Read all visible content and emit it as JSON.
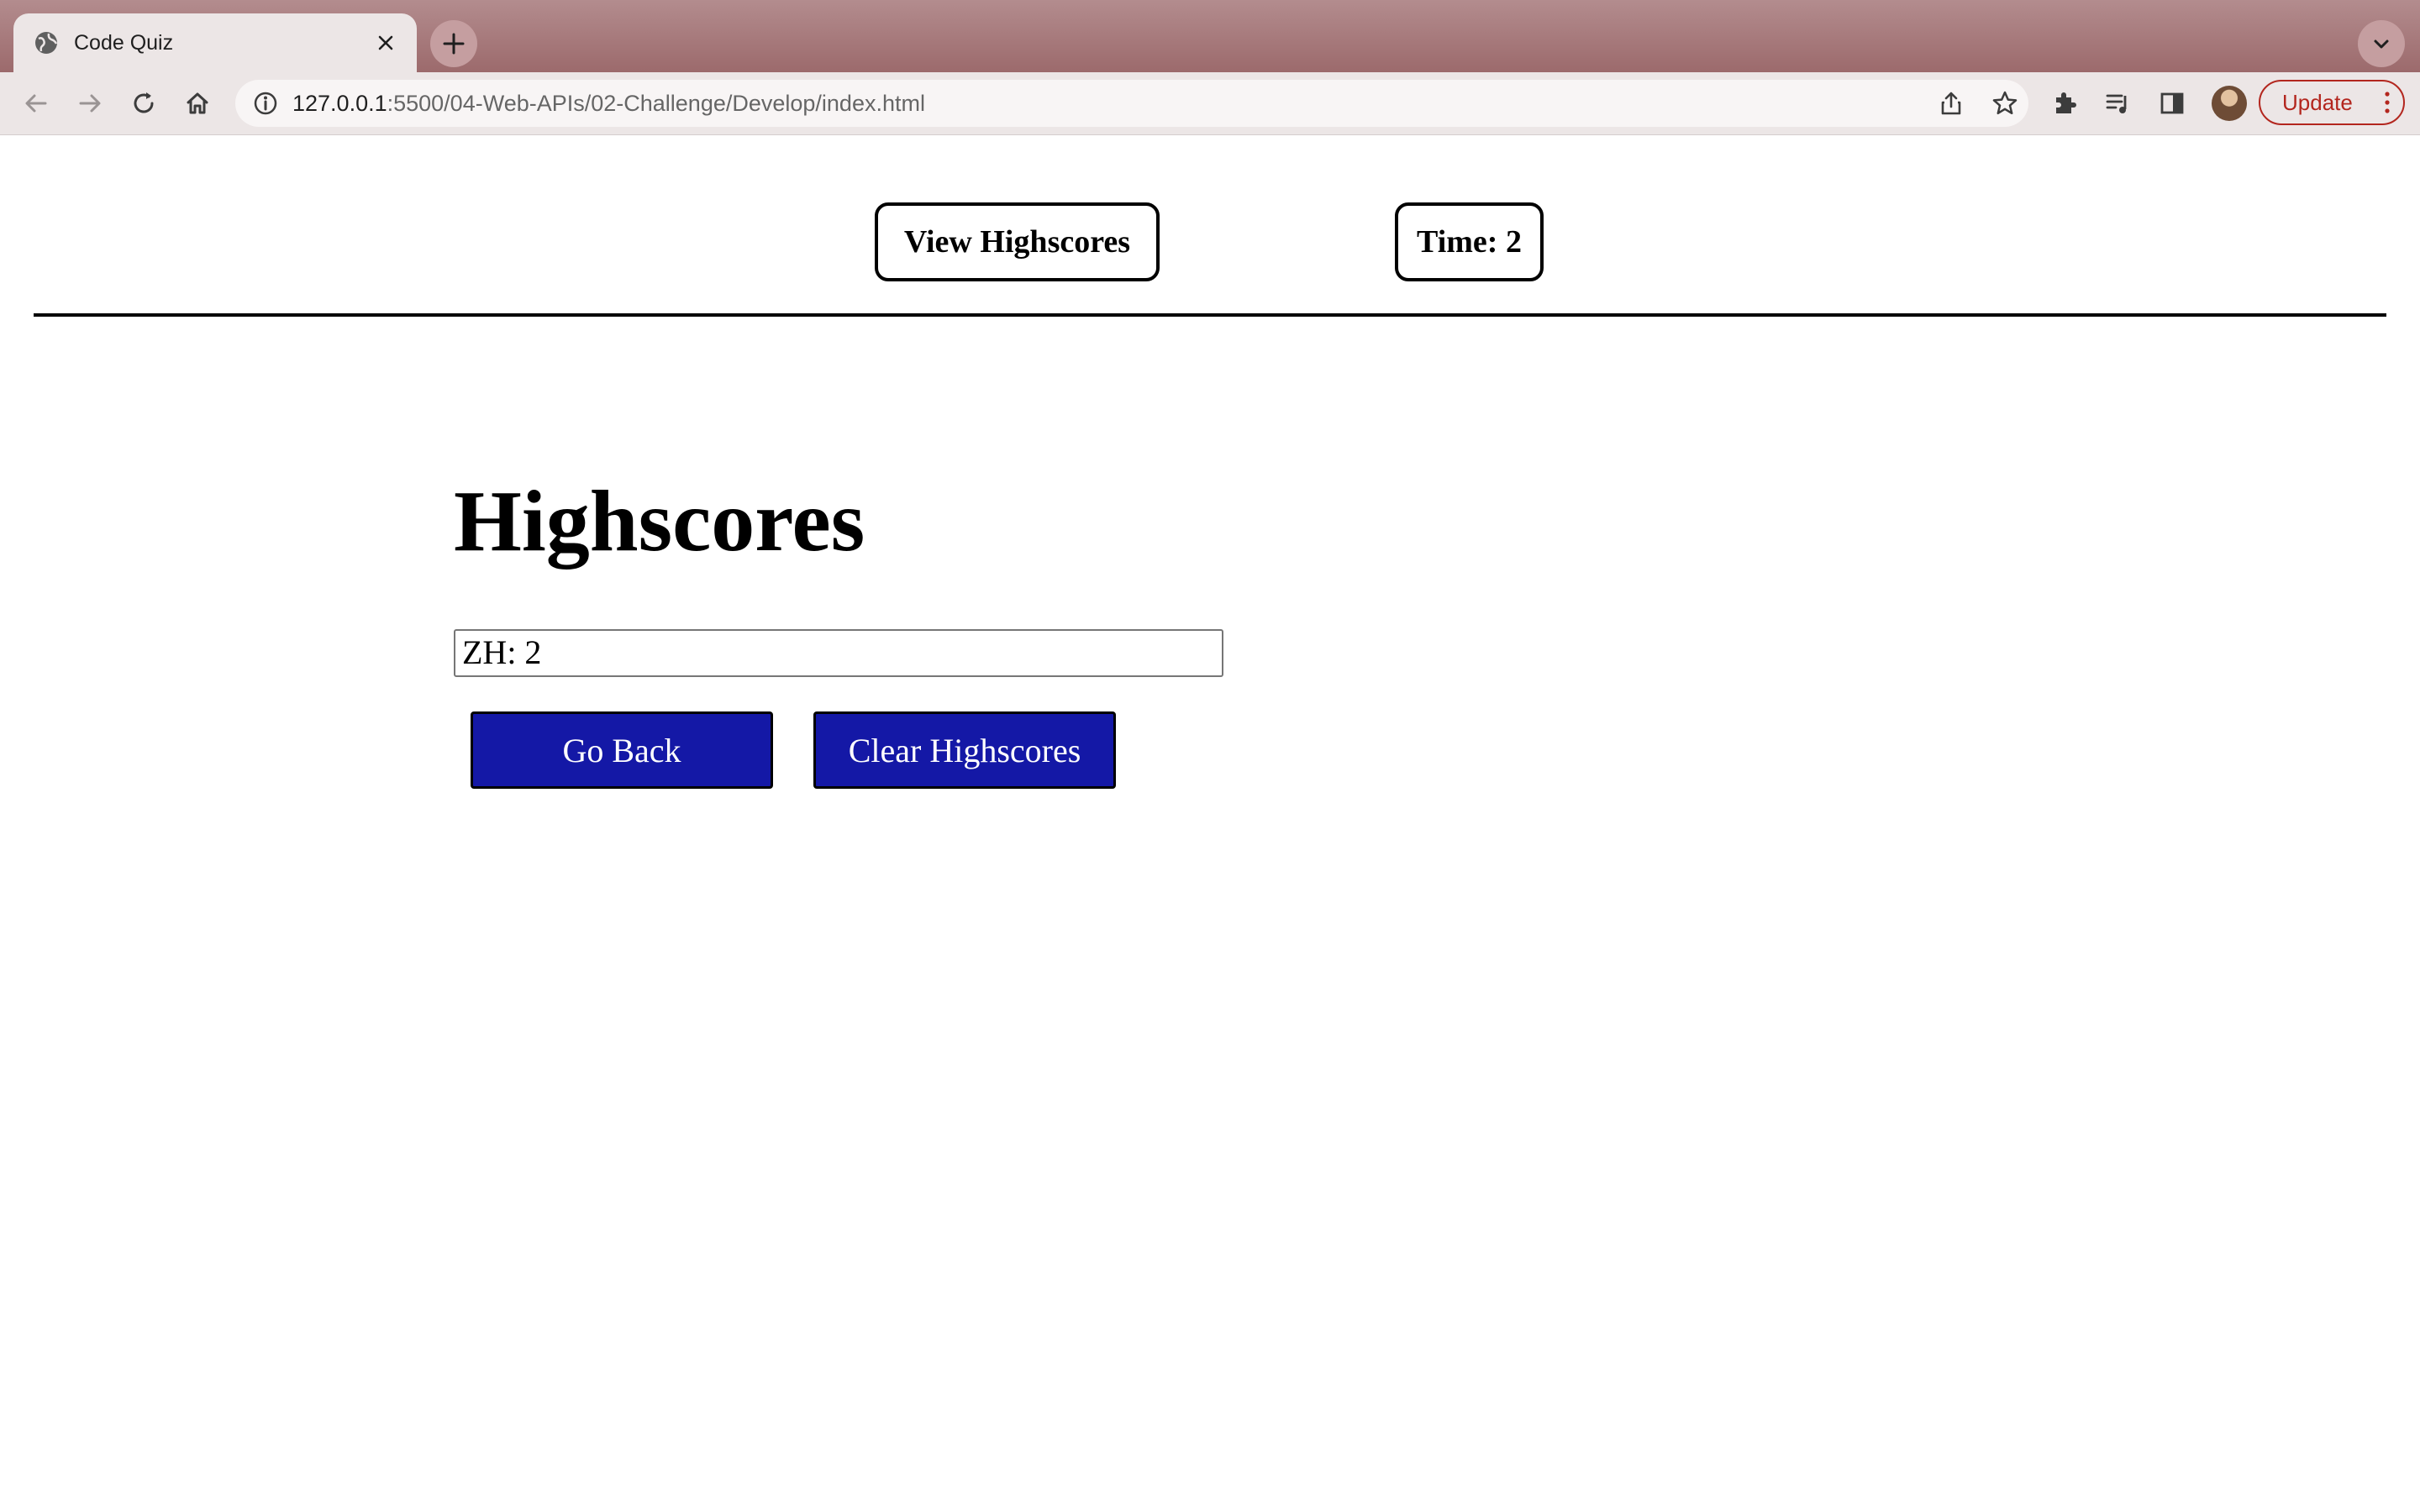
{
  "browser": {
    "tab_title": "Code Quiz",
    "url_host": "127.0.0.1",
    "url_rest": ":5500/04-Web-APIs/02-Challenge/Develop/index.html",
    "update_label": "Update"
  },
  "header": {
    "view_highscores": "View Highscores",
    "timer": "Time: 2"
  },
  "main": {
    "title": "Highscores",
    "scores": [
      "ZH: 2"
    ],
    "go_back_label": "Go Back",
    "clear_label": "Clear Highscores"
  },
  "colors": {
    "tabstrip": "#9c6a6c",
    "button_blue": "#1418a6",
    "update_red": "#b3261e"
  }
}
